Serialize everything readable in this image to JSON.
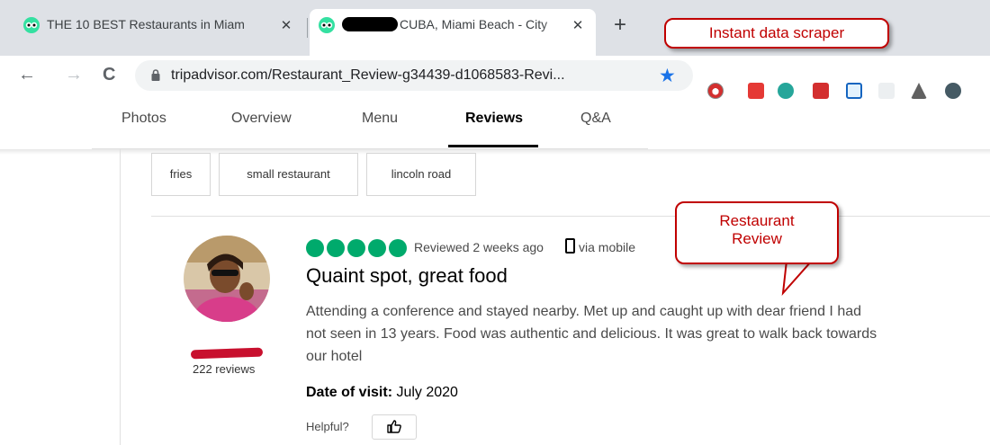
{
  "browser": {
    "tabs": [
      {
        "title": "THE 10 BEST Restaurants in Miam",
        "close": "✕"
      },
      {
        "title": "CUBA, Miami Beach - City",
        "close": "✕"
      }
    ],
    "new_tab": "+",
    "back": "←",
    "forward": "→",
    "reload": "C",
    "url": "tripadvisor.com/Restaurant_Review-g34439-d1068583-Revi...",
    "bookmark": "★"
  },
  "annotations": {
    "callout1": "Instant data scraper",
    "callout2_line1": "Restaurant",
    "callout2_line2": "Review"
  },
  "page_nav": {
    "tabs": [
      "Photos",
      "Overview",
      "Menu",
      "Reviews",
      "Q&A"
    ],
    "active": "Reviews"
  },
  "tags": [
    "fries",
    "small restaurant",
    "lincoln road"
  ],
  "review": {
    "rating": 5,
    "reviewed": "Reviewed 2 weeks ago",
    "via": "via mobile",
    "title": "Quaint spot, great food",
    "lines": [
      "Attending a conference and stayed nearby. Met up and caught up with dear friend I had",
      "not seen in 13 years. Food was authentic and delicious. It was great to walk back towards",
      "our hotel"
    ],
    "date_label": "Date of visit:",
    "date_value": " July 2020",
    "helpful": "Helpful?",
    "helpful_icon": "thumbs-up-icon",
    "reviewer_reviews": "222 reviews"
  },
  "colors": {
    "accent_green": "#00aa6c",
    "callout_red": "#c00000",
    "star_blue": "#1a73e8"
  }
}
